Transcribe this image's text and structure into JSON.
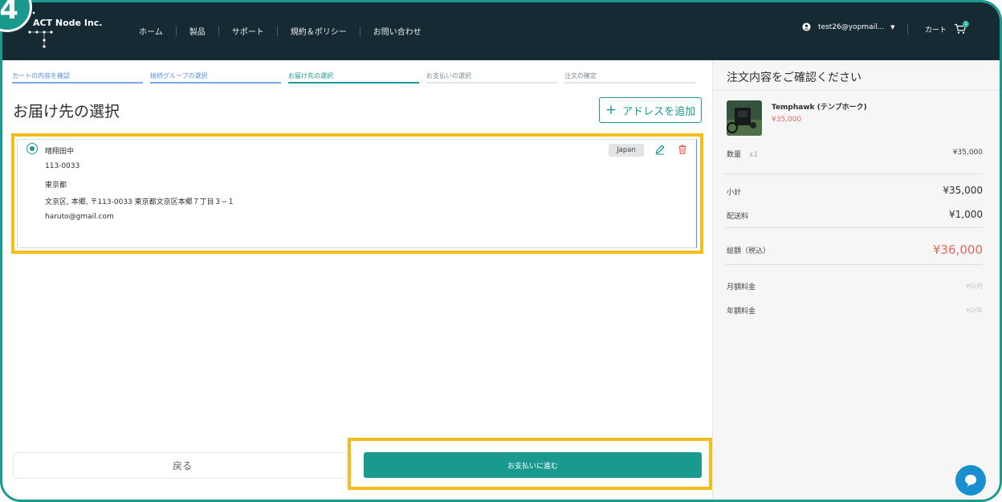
{
  "header": {
    "logo_text": "ACT Node Inc.",
    "nav": [
      "ホーム",
      "製品",
      "サポート",
      "規約＆ポリシー",
      "お問い合わせ"
    ],
    "user_email": "test26@yopmail...",
    "cart_label": "カート",
    "cart_count": "1"
  },
  "steps": [
    {
      "label": "カートの内容を確認",
      "state": "done"
    },
    {
      "label": "接続グループの選択",
      "state": "done"
    },
    {
      "label": "お届け先の選択",
      "state": "active"
    },
    {
      "label": "お支払いの選択",
      "state": "pending"
    },
    {
      "label": "注文の確定",
      "state": "pending"
    }
  ],
  "main": {
    "title": "お届け先の選択",
    "add_address_label": "アドレスを追加"
  },
  "address": {
    "name": "晴翔田中",
    "postal": "113-0033",
    "prefecture": "東京都",
    "address_line": "文京区, 本郷, 〒113-0033 東京都文京区本郷７丁目３−１",
    "email": "haruto@gmail.com",
    "country": "Japan"
  },
  "buttons": {
    "back": "戻る",
    "proceed": "お支払いに進む"
  },
  "summary": {
    "title": "注文内容をご確認ください",
    "product_name": "Temphawk (テンプホーク)",
    "product_price": "¥35,000",
    "qty_label": "数量",
    "qty_value": "x1",
    "qty_price": "¥35,000",
    "subtotal_label": "小計",
    "subtotal": "¥35,000",
    "shipping_label": "配送料",
    "shipping": "¥1,000",
    "total_label": "総額（税込）",
    "total": "¥36,000",
    "monthly_label": "月額料金",
    "monthly": "¥0/月",
    "yearly_label": "年額料金",
    "yearly": "¥0/年"
  },
  "colors": {
    "accent": "#1a9a8f",
    "header_bg": "#162a33",
    "highlight": "#f5bd19",
    "price_red": "#e46a5d",
    "step_done": "#5a8fe0"
  },
  "icons": {
    "user": "user-circle-icon",
    "cart": "cart-icon",
    "edit": "pencil-icon",
    "delete": "trash-icon",
    "chat": "chat-icon"
  }
}
